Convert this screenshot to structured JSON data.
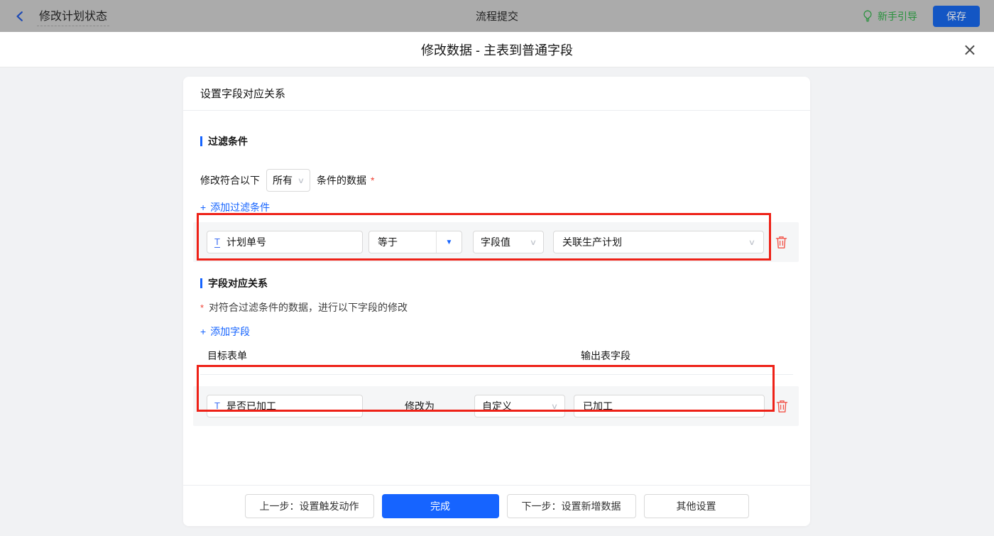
{
  "topbar": {
    "back_title": "修改计划状态",
    "center_title": "流程提交",
    "guide_label": "新手引导",
    "save_label": "保存"
  },
  "modal": {
    "title": "修改数据 - 主表到普通字段",
    "card_header": "设置字段对应关系",
    "filter_section": {
      "heading": "过滤条件",
      "match_prefix": "修改符合以下",
      "match_select_value": "所有",
      "match_suffix": "条件的数据",
      "required_mark": "*",
      "add_link_label": "添加过滤条件",
      "condition_row": {
        "field_value": "计划单号",
        "operator": "等于",
        "value_type": "字段值",
        "value": "关联生产计划"
      }
    },
    "mapping_section": {
      "heading": "字段对应关系",
      "required_mark": "*",
      "description": "对符合过滤条件的数据，进行以下字段的修改",
      "add_link_label": "添加字段",
      "col_target": "目标表单",
      "col_output": "输出表字段",
      "mapping_row": {
        "field_value": "是否已加工",
        "modify_label": "修改为",
        "mode": "自定义",
        "value": "已加工"
      }
    },
    "footer": {
      "prev_label": "上一步：设置触发动作",
      "done_label": "完成",
      "next_label": "下一步：设置新增数据",
      "other_label": "其他设置"
    }
  },
  "icons": {
    "plus": "+",
    "chevron_down": "∨",
    "caret_down": "▼",
    "close": "×",
    "text_field": "T"
  },
  "colors": {
    "accent_blue": "#1664ff",
    "annotation_red": "#ee2117",
    "danger_red": "#f2554b",
    "guide_green": "#28913c",
    "topbar_dimmed": "#ababab"
  }
}
